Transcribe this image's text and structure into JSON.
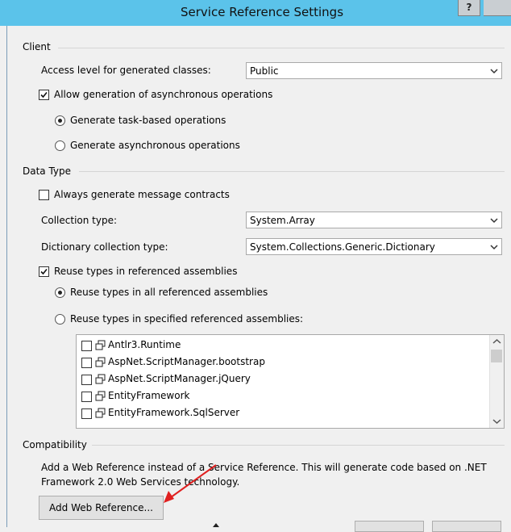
{
  "window": {
    "title": "Service Reference Settings",
    "help_label": "?"
  },
  "client": {
    "section": "Client",
    "access_level_label": "Access level for generated classes:",
    "access_level_value": "Public",
    "allow_async_label": "Allow generation of asynchronous operations",
    "allow_async_checked": true,
    "task_based_label": "Generate task-based operations",
    "async_ops_label": "Generate asynchronous operations",
    "selected_async_mode": "task-based"
  },
  "data_type": {
    "section": "Data Type",
    "always_contracts_label": "Always generate message contracts",
    "always_contracts_checked": false,
    "collection_type_label": "Collection type:",
    "collection_type_value": "System.Array",
    "dictionary_type_label": "Dictionary collection type:",
    "dictionary_type_value": "System.Collections.Generic.Dictionary",
    "reuse_types_label": "Reuse types in referenced assemblies",
    "reuse_types_checked": true,
    "reuse_all_label": "Reuse types in all referenced assemblies",
    "reuse_specified_label": "Reuse types in specified referenced assemblies:",
    "selected_reuse_mode": "all",
    "assemblies": [
      "Antlr3.Runtime",
      "AspNet.ScriptManager.bootstrap",
      "AspNet.ScriptManager.jQuery",
      "EntityFramework",
      "EntityFramework.SqlServer"
    ]
  },
  "compatibility": {
    "section": "Compatibility",
    "description_line1": "Add a Web Reference instead of a Service Reference. This will generate code based on .NET",
    "description_line2": "Framework 2.0 Web Services technology.",
    "add_web_reference_label": "Add Web Reference..."
  },
  "colors": {
    "titlebar": "#5bc3ea",
    "annotation_arrow": "#e02020"
  }
}
